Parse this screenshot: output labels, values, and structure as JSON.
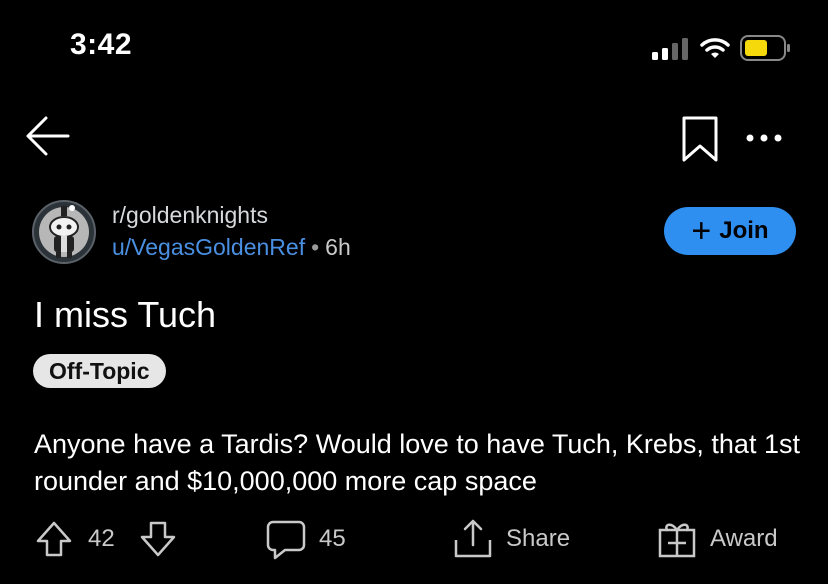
{
  "status_bar": {
    "time": "3:42"
  },
  "header": {
    "subreddit": "r/goldenknights",
    "username": "u/VegasGoldenRef",
    "separator": "•",
    "age": "6h",
    "join_label": "Join"
  },
  "post": {
    "title": "I miss Tuch",
    "flair": "Off-Topic",
    "body": "Anyone have a Tardis? Would love to have Tuch, Krebs, that 1st rounder and $10,000,000 more cap space"
  },
  "actions": {
    "score": "42",
    "comments": "45",
    "share_label": "Share",
    "award_label": "Award"
  },
  "colors": {
    "background": "#000000",
    "accent_blue": "#2f8ff0",
    "username_blue": "#4a90e2",
    "battery_yellow": "#f5d90a"
  }
}
